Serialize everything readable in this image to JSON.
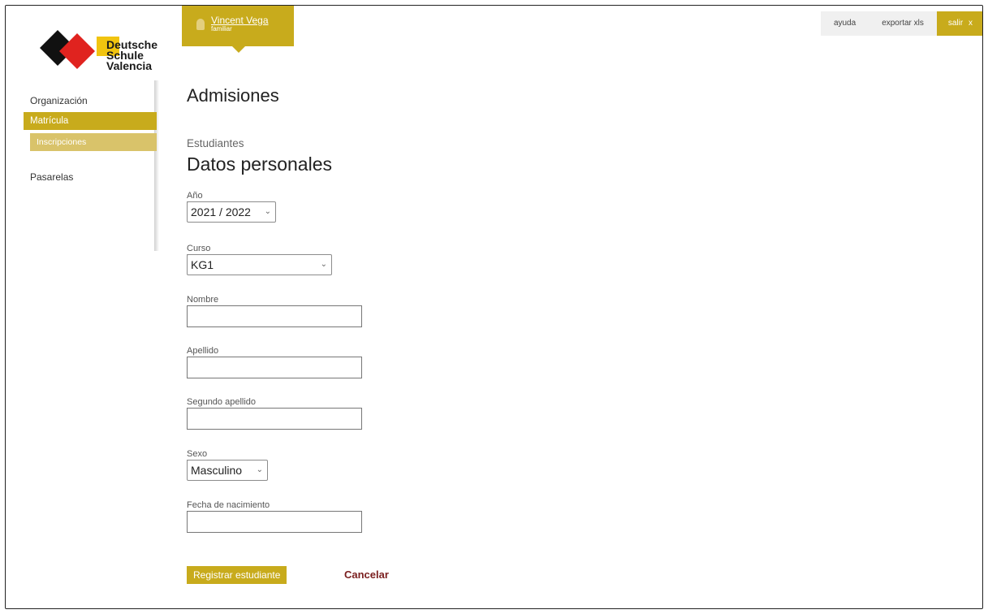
{
  "logo": {
    "line1": "Deutsche",
    "line2": "Schule",
    "line3": "Valencia"
  },
  "user": {
    "name": "Vincent Vega",
    "role": "familiar"
  },
  "topbar": {
    "help": "ayuda",
    "export": "exportar xls",
    "logout": "salir",
    "logout_icon": "x"
  },
  "sidebar": {
    "items": [
      {
        "label": "Organización"
      },
      {
        "label": "Matrícula"
      },
      {
        "label": "Inscripciones"
      },
      {
        "label": "Pasarelas"
      }
    ]
  },
  "page": {
    "title": "Admisiones",
    "subtitle": "Estudiantes",
    "section": "Datos personales"
  },
  "form": {
    "year": {
      "label": "Año",
      "value": "2021 / 2022"
    },
    "course": {
      "label": "Curso",
      "value": "KG1"
    },
    "first_name": {
      "label": "Nombre",
      "value": ""
    },
    "last_name": {
      "label": "Apellido",
      "value": ""
    },
    "second_last_name": {
      "label": "Segundo apellido",
      "value": ""
    },
    "sex": {
      "label": "Sexo",
      "value": "Masculino"
    },
    "birth_date": {
      "label": "Fecha de nacimiento",
      "value": ""
    }
  },
  "actions": {
    "submit": "Registrar estudiante",
    "cancel": "Cancelar"
  },
  "colors": {
    "accent": "#c8ab1c",
    "accent_light": "#d9c36a",
    "cancel": "#7a1e1e"
  }
}
